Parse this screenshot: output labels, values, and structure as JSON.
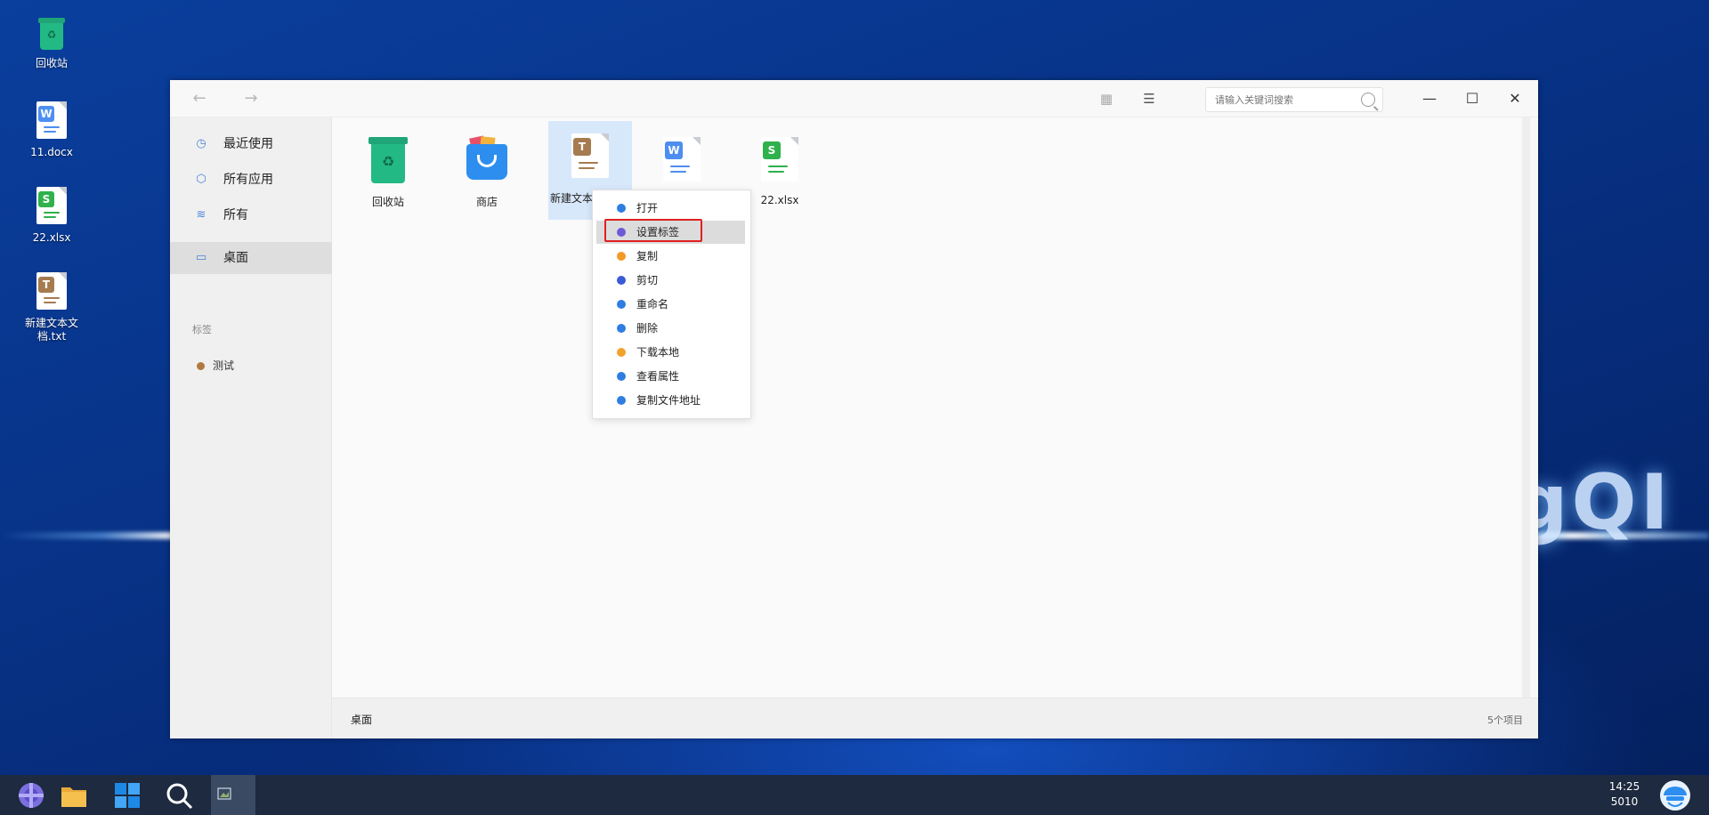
{
  "desktop": {
    "icons": [
      {
        "label": "回收站",
        "icon": "recycle-bin-icon"
      },
      {
        "label": "11.docx",
        "icon": "docx-file-icon"
      },
      {
        "label": "22.xlsx",
        "icon": "xlsx-file-icon"
      },
      {
        "label": "新建文本文档.txt",
        "icon": "txt-file-icon"
      }
    ],
    "background_text": "gQI"
  },
  "window": {
    "toolbar": {
      "back_icon": "arrow-left-icon",
      "forward_icon": "arrow-right-icon",
      "grid_view_icon": "grid-view-icon",
      "list_view_icon": "list-view-icon",
      "search_placeholder": "请输入关键词搜索",
      "minimize_icon": "minimize-icon",
      "maximize_icon": "maximize-icon",
      "close_icon": "close-icon"
    },
    "sidebar": {
      "items": [
        {
          "label": "最近使用",
          "icon": "clock-icon"
        },
        {
          "label": "所有应用",
          "icon": "cube-icon"
        },
        {
          "label": "所有",
          "icon": "layers-icon"
        },
        {
          "label": "桌面",
          "icon": "monitor-icon",
          "active": true
        }
      ],
      "tags_heading": "标签",
      "tags": [
        {
          "label": "测试",
          "color": "#b07a3e"
        }
      ]
    },
    "files": [
      {
        "label": "回收站",
        "icon": "recycle-bin-icon"
      },
      {
        "label": "商店",
        "icon": "store-bag-icon"
      },
      {
        "label": "新建文本",
        "icon": "txt-file-icon",
        "selected": true
      },
      {
        "label": "",
        "icon": "docx-file-icon"
      },
      {
        "label": "22.xlsx",
        "icon": "xlsx-file-icon"
      }
    ],
    "status": {
      "location": "桌面",
      "count": "5个项目"
    }
  },
  "context_menu": {
    "items": [
      {
        "label": "打开",
        "color": "#2f7de1"
      },
      {
        "label": "设置标签",
        "color": "#6b5bd6",
        "highlighted": true
      },
      {
        "label": "复制",
        "color": "#f09a26"
      },
      {
        "label": "剪切",
        "color": "#3a5bd6"
      },
      {
        "label": "重命名",
        "color": "#2f7de1"
      },
      {
        "label": "删除",
        "color": "#2f7de1"
      },
      {
        "label": "下载本地",
        "color": "#f0a22a"
      },
      {
        "label": "查看属性",
        "color": "#2f7de1"
      },
      {
        "label": "复制文件地址",
        "color": "#2f7de1"
      }
    ]
  },
  "taskbar": {
    "time": "14:25",
    "date": "5010",
    "apps": [
      "launcher-icon",
      "file-manager-icon",
      "app-store-icon",
      "search-icon",
      "broken-image-icon"
    ]
  },
  "colors": {
    "accent": "#4a86d8",
    "highlight_border": "#e02020"
  }
}
